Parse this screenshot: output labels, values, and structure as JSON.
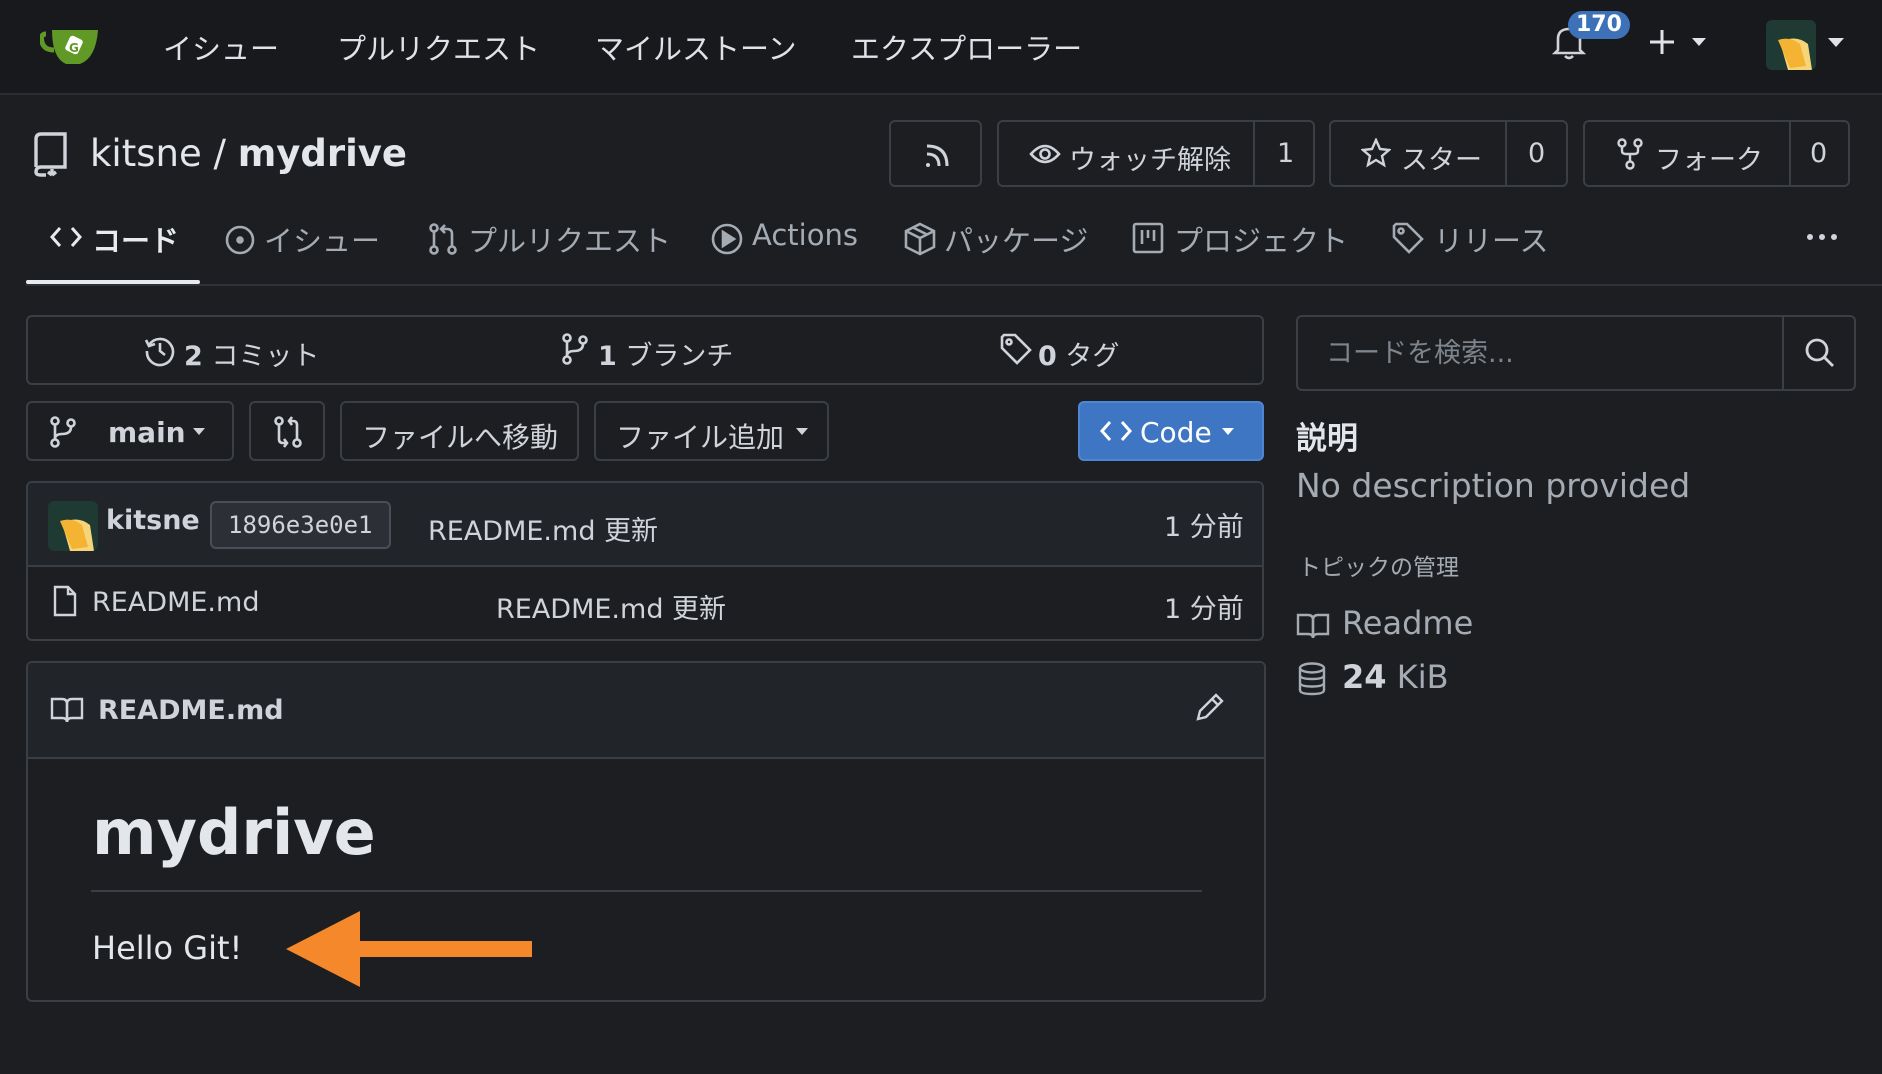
{
  "nav": {
    "links": [
      "イシュー",
      "プルリクエスト",
      "マイルストーン",
      "エクスプローラー"
    ],
    "notification_count": "170"
  },
  "repo": {
    "owner": "kitsne",
    "separator": "/",
    "name": "mydrive",
    "unwatch_label": "ウォッチ解除",
    "watch_count": "1",
    "star_label": "スター",
    "star_count": "0",
    "fork_label": "フォーク",
    "fork_count": "0"
  },
  "tabs": [
    {
      "label": "コード",
      "active": true
    },
    {
      "label": "イシュー"
    },
    {
      "label": "プルリクエスト"
    },
    {
      "label": "Actions"
    },
    {
      "label": "パッケージ"
    },
    {
      "label": "プロジェクト"
    },
    {
      "label": "リリース"
    }
  ],
  "stats": {
    "commits_count": "2",
    "commits_label": "コミット",
    "branches_count": "1",
    "branches_label": "ブランチ",
    "tags_count": "0",
    "tags_label": "タグ"
  },
  "controls": {
    "branch": "main",
    "goto_file": "ファイルへ移動",
    "add_file": "ファイル追加",
    "code": "Code"
  },
  "latest_commit": {
    "author": "kitsne",
    "sha": "1896e3e0e1",
    "message": "README.md 更新",
    "time": "1 分前"
  },
  "files": [
    {
      "name": "README.md",
      "message": "README.md 更新",
      "time": "1 分前"
    }
  ],
  "readme": {
    "filename": "README.md",
    "heading": "mydrive",
    "body": "Hello Git!"
  },
  "sidebar": {
    "search_placeholder": "コードを検索...",
    "about_title": "説明",
    "description": "No description provided",
    "topics_link": "トピックの管理",
    "readme_link": "Readme",
    "size_value": "24",
    "size_unit": "KiB"
  },
  "colors": {
    "background": "#1c1e22",
    "accent_blue": "#3f76c4",
    "annotation_arrow": "#f5882a"
  }
}
